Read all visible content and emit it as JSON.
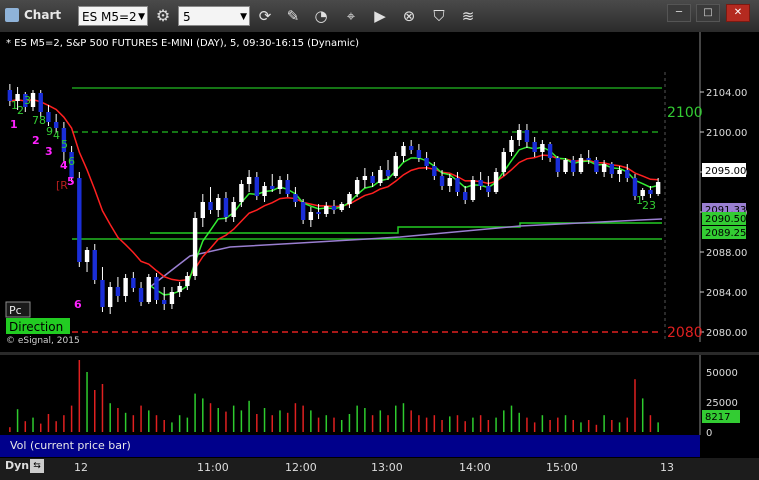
{
  "window": {
    "title": "Chart",
    "symbol": "ES M5=2",
    "interval": "5",
    "controls": {
      "minimize": "─",
      "maximize": "□",
      "close": "✕"
    }
  },
  "toolbar_icons": [
    "refresh-icon",
    "draw-pencil-icon",
    "ruler-icon",
    "cursor-icon",
    "play-icon",
    "remove-icon",
    "tag-icon",
    "lines-icon"
  ],
  "chart": {
    "header": "* ES M5=2, S&P 500 FUTURES E-MINI (DAY), 5, 09:30-16:15 (Dynamic)",
    "copyright": "© eSignal, 2015",
    "price_ticks": [
      "2104.00",
      "2100.00",
      "2096.00",
      "2092.00",
      "2088.00",
      "2084.00",
      "2080.00"
    ],
    "last_price": "2095.00",
    "badges": [
      {
        "label": "2091.33",
        "color": "#9a7fd1",
        "text_color": "#000"
      },
      {
        "label": "2090.50",
        "color": "#33cc33",
        "text_color": "#000"
      },
      {
        "label": "2089.25",
        "color": "#33cc33",
        "text_color": "#000"
      }
    ],
    "level_labels": [
      {
        "label": "2100",
        "color": "#33cc33"
      },
      {
        "label": "2080",
        "color": "#e02020"
      }
    ],
    "pc_label": "Pc",
    "direction_label": "Direction",
    "r_label": "[R",
    "count_labels": [
      "1",
      "2",
      "3",
      "1",
      "2",
      "3",
      "4",
      "5",
      "6",
      "7",
      "8",
      "9",
      "4",
      "5",
      "6",
      "1",
      "23"
    ]
  },
  "volume": {
    "legend": "Vol (current price bar)",
    "ticks": [
      "50000",
      "25000",
      "0"
    ],
    "last_value": "8217"
  },
  "time_axis": {
    "dyn_label": "Dyn",
    "labels": [
      "12",
      "11:00",
      "12:00",
      "13:00",
      "14:00",
      "15:00",
      "13"
    ]
  },
  "chart_data": {
    "type": "candlestick",
    "ylim": [
      2079,
      2106
    ],
    "candles": [
      [
        2104.2,
        2104.8,
        2102.6,
        2103.1
      ],
      [
        2103.1,
        2104.5,
        2102.2,
        2103.8
      ],
      [
        2103.8,
        2104.0,
        2102.0,
        2102.5
      ],
      [
        2102.5,
        2104.2,
        2102.1,
        2103.9
      ],
      [
        2103.9,
        2104.2,
        2101.5,
        2102.0
      ],
      [
        2102.0,
        2102.7,
        2100.6,
        2101.0
      ],
      [
        2101.0,
        2101.8,
        2099.9,
        2100.4
      ],
      [
        2100.4,
        2101.0,
        2097.0,
        2098.0
      ],
      [
        2098.0,
        2098.6,
        2095.0,
        2095.4
      ],
      [
        2095.4,
        2096.0,
        2086.5,
        2087.0
      ],
      [
        2087.0,
        2088.5,
        2086.0,
        2088.2
      ],
      [
        2088.2,
        2088.8,
        2084.8,
        2085.2
      ],
      [
        2085.2,
        2086.5,
        2082.0,
        2082.5
      ],
      [
        2082.5,
        2085.0,
        2081.8,
        2084.5
      ],
      [
        2084.5,
        2085.5,
        2083.0,
        2083.6
      ],
      [
        2083.6,
        2085.8,
        2083.0,
        2085.4
      ],
      [
        2085.4,
        2086.0,
        2084.0,
        2084.4
      ],
      [
        2084.4,
        2085.0,
        2082.6,
        2083.0
      ],
      [
        2083.0,
        2085.8,
        2082.8,
        2085.5
      ],
      [
        2085.5,
        2085.9,
        2082.8,
        2083.2
      ],
      [
        2083.2,
        2084.5,
        2082.2,
        2082.8
      ],
      [
        2082.8,
        2084.5,
        2082.3,
        2084.0
      ],
      [
        2084.0,
        2085.0,
        2083.5,
        2084.6
      ],
      [
        2084.6,
        2086.0,
        2084.2,
        2085.6
      ],
      [
        2085.6,
        2092.0,
        2085.2,
        2091.4
      ],
      [
        2091.4,
        2093.8,
        2090.5,
        2093.0
      ],
      [
        2093.0,
        2094.5,
        2091.8,
        2092.2
      ],
      [
        2092.2,
        2093.8,
        2091.5,
        2093.4
      ],
      [
        2093.4,
        2094.0,
        2091.0,
        2091.5
      ],
      [
        2091.5,
        2093.5,
        2091.0,
        2093.0
      ],
      [
        2093.0,
        2095.2,
        2092.5,
        2094.8
      ],
      [
        2094.8,
        2096.2,
        2094.0,
        2095.5
      ],
      [
        2095.5,
        2096.0,
        2093.2,
        2093.6
      ],
      [
        2093.6,
        2095.0,
        2093.0,
        2094.6
      ],
      [
        2094.6,
        2095.8,
        2094.0,
        2094.3
      ],
      [
        2094.3,
        2095.6,
        2093.8,
        2095.2
      ],
      [
        2095.2,
        2095.8,
        2093.5,
        2093.8
      ],
      [
        2093.8,
        2094.5,
        2092.5,
        2093.0
      ],
      [
        2093.0,
        2093.3,
        2090.8,
        2091.2
      ],
      [
        2091.2,
        2092.5,
        2090.5,
        2092.0
      ],
      [
        2092.0,
        2092.8,
        2091.3,
        2091.8
      ],
      [
        2091.8,
        2093.0,
        2091.5,
        2092.6
      ],
      [
        2092.6,
        2093.2,
        2091.8,
        2092.2
      ],
      [
        2092.2,
        2093.0,
        2092.0,
        2092.8
      ],
      [
        2092.8,
        2094.0,
        2092.4,
        2093.8
      ],
      [
        2093.8,
        2095.5,
        2093.5,
        2095.2
      ],
      [
        2095.2,
        2096.4,
        2094.4,
        2095.6
      ],
      [
        2095.6,
        2096.0,
        2094.5,
        2094.9
      ],
      [
        2094.9,
        2096.6,
        2094.6,
        2096.2
      ],
      [
        2096.2,
        2097.2,
        2095.2,
        2095.6
      ],
      [
        2095.6,
        2098.0,
        2095.4,
        2097.6
      ],
      [
        2097.6,
        2099.0,
        2097.0,
        2098.6
      ],
      [
        2098.6,
        2099.2,
        2097.8,
        2098.2
      ],
      [
        2098.2,
        2098.8,
        2097.0,
        2097.4
      ],
      [
        2097.4,
        2098.0,
        2096.2,
        2096.6
      ],
      [
        2096.6,
        2097.0,
        2095.2,
        2095.6
      ],
      [
        2095.6,
        2096.2,
        2094.2,
        2094.6
      ],
      [
        2094.6,
        2095.8,
        2094.0,
        2095.4
      ],
      [
        2095.4,
        2096.0,
        2093.6,
        2094.0
      ],
      [
        2094.0,
        2094.6,
        2092.8,
        2093.2
      ],
      [
        2093.2,
        2095.6,
        2093.0,
        2095.2
      ],
      [
        2095.2,
        2096.0,
        2094.2,
        2094.6
      ],
      [
        2094.6,
        2095.6,
        2093.5,
        2094.0
      ],
      [
        2094.0,
        2096.4,
        2093.8,
        2096.0
      ],
      [
        2096.0,
        2098.4,
        2095.6,
        2098.0
      ],
      [
        2098.0,
        2099.6,
        2097.6,
        2099.2
      ],
      [
        2099.2,
        2100.8,
        2098.6,
        2100.2
      ],
      [
        2100.2,
        2100.8,
        2098.4,
        2099.0
      ],
      [
        2099.0,
        2099.5,
        2097.5,
        2098.0
      ],
      [
        2098.0,
        2099.2,
        2097.2,
        2098.8
      ],
      [
        2098.8,
        2099.0,
        2097.0,
        2097.4
      ],
      [
        2097.4,
        2097.6,
        2095.5,
        2096.0
      ],
      [
        2096.0,
        2097.4,
        2095.8,
        2097.2
      ],
      [
        2097.2,
        2097.6,
        2095.6,
        2096.0
      ],
      [
        2096.0,
        2097.8,
        2095.8,
        2097.4
      ],
      [
        2097.4,
        2098.2,
        2096.8,
        2097.2
      ],
      [
        2097.2,
        2097.5,
        2095.8,
        2096.0
      ],
      [
        2096.0,
        2097.2,
        2095.5,
        2096.8
      ],
      [
        2096.8,
        2097.0,
        2095.4,
        2095.8
      ],
      [
        2095.8,
        2096.6,
        2095.0,
        2096.2
      ],
      [
        2096.2,
        2096.8,
        2095.0,
        2095.4
      ],
      [
        2095.4,
        2095.8,
        2093.2,
        2093.6
      ],
      [
        2093.6,
        2094.4,
        2093.2,
        2094.2
      ],
      [
        2094.2,
        2094.6,
        2093.4,
        2093.8
      ],
      [
        2093.8,
        2095.4,
        2093.6,
        2095.0
      ]
    ],
    "volumes": [
      4,
      19,
      9,
      12,
      7,
      15,
      9,
      14,
      22,
      60,
      50,
      35,
      40,
      24,
      20,
      16,
      14,
      22,
      18,
      14,
      10,
      8,
      14,
      12,
      32,
      28,
      24,
      20,
      17,
      22,
      18,
      26,
      15,
      20,
      14,
      18,
      16,
      24,
      22,
      18,
      12,
      14,
      12,
      10,
      15,
      22,
      20,
      14,
      18,
      14,
      22,
      24,
      18,
      14,
      12,
      14,
      10,
      13,
      14,
      9,
      12,
      14,
      10,
      12,
      18,
      22,
      16,
      12,
      8,
      14,
      10,
      12,
      14,
      10,
      8,
      10,
      6,
      14,
      10,
      8,
      12,
      44,
      28,
      14,
      8
    ]
  }
}
